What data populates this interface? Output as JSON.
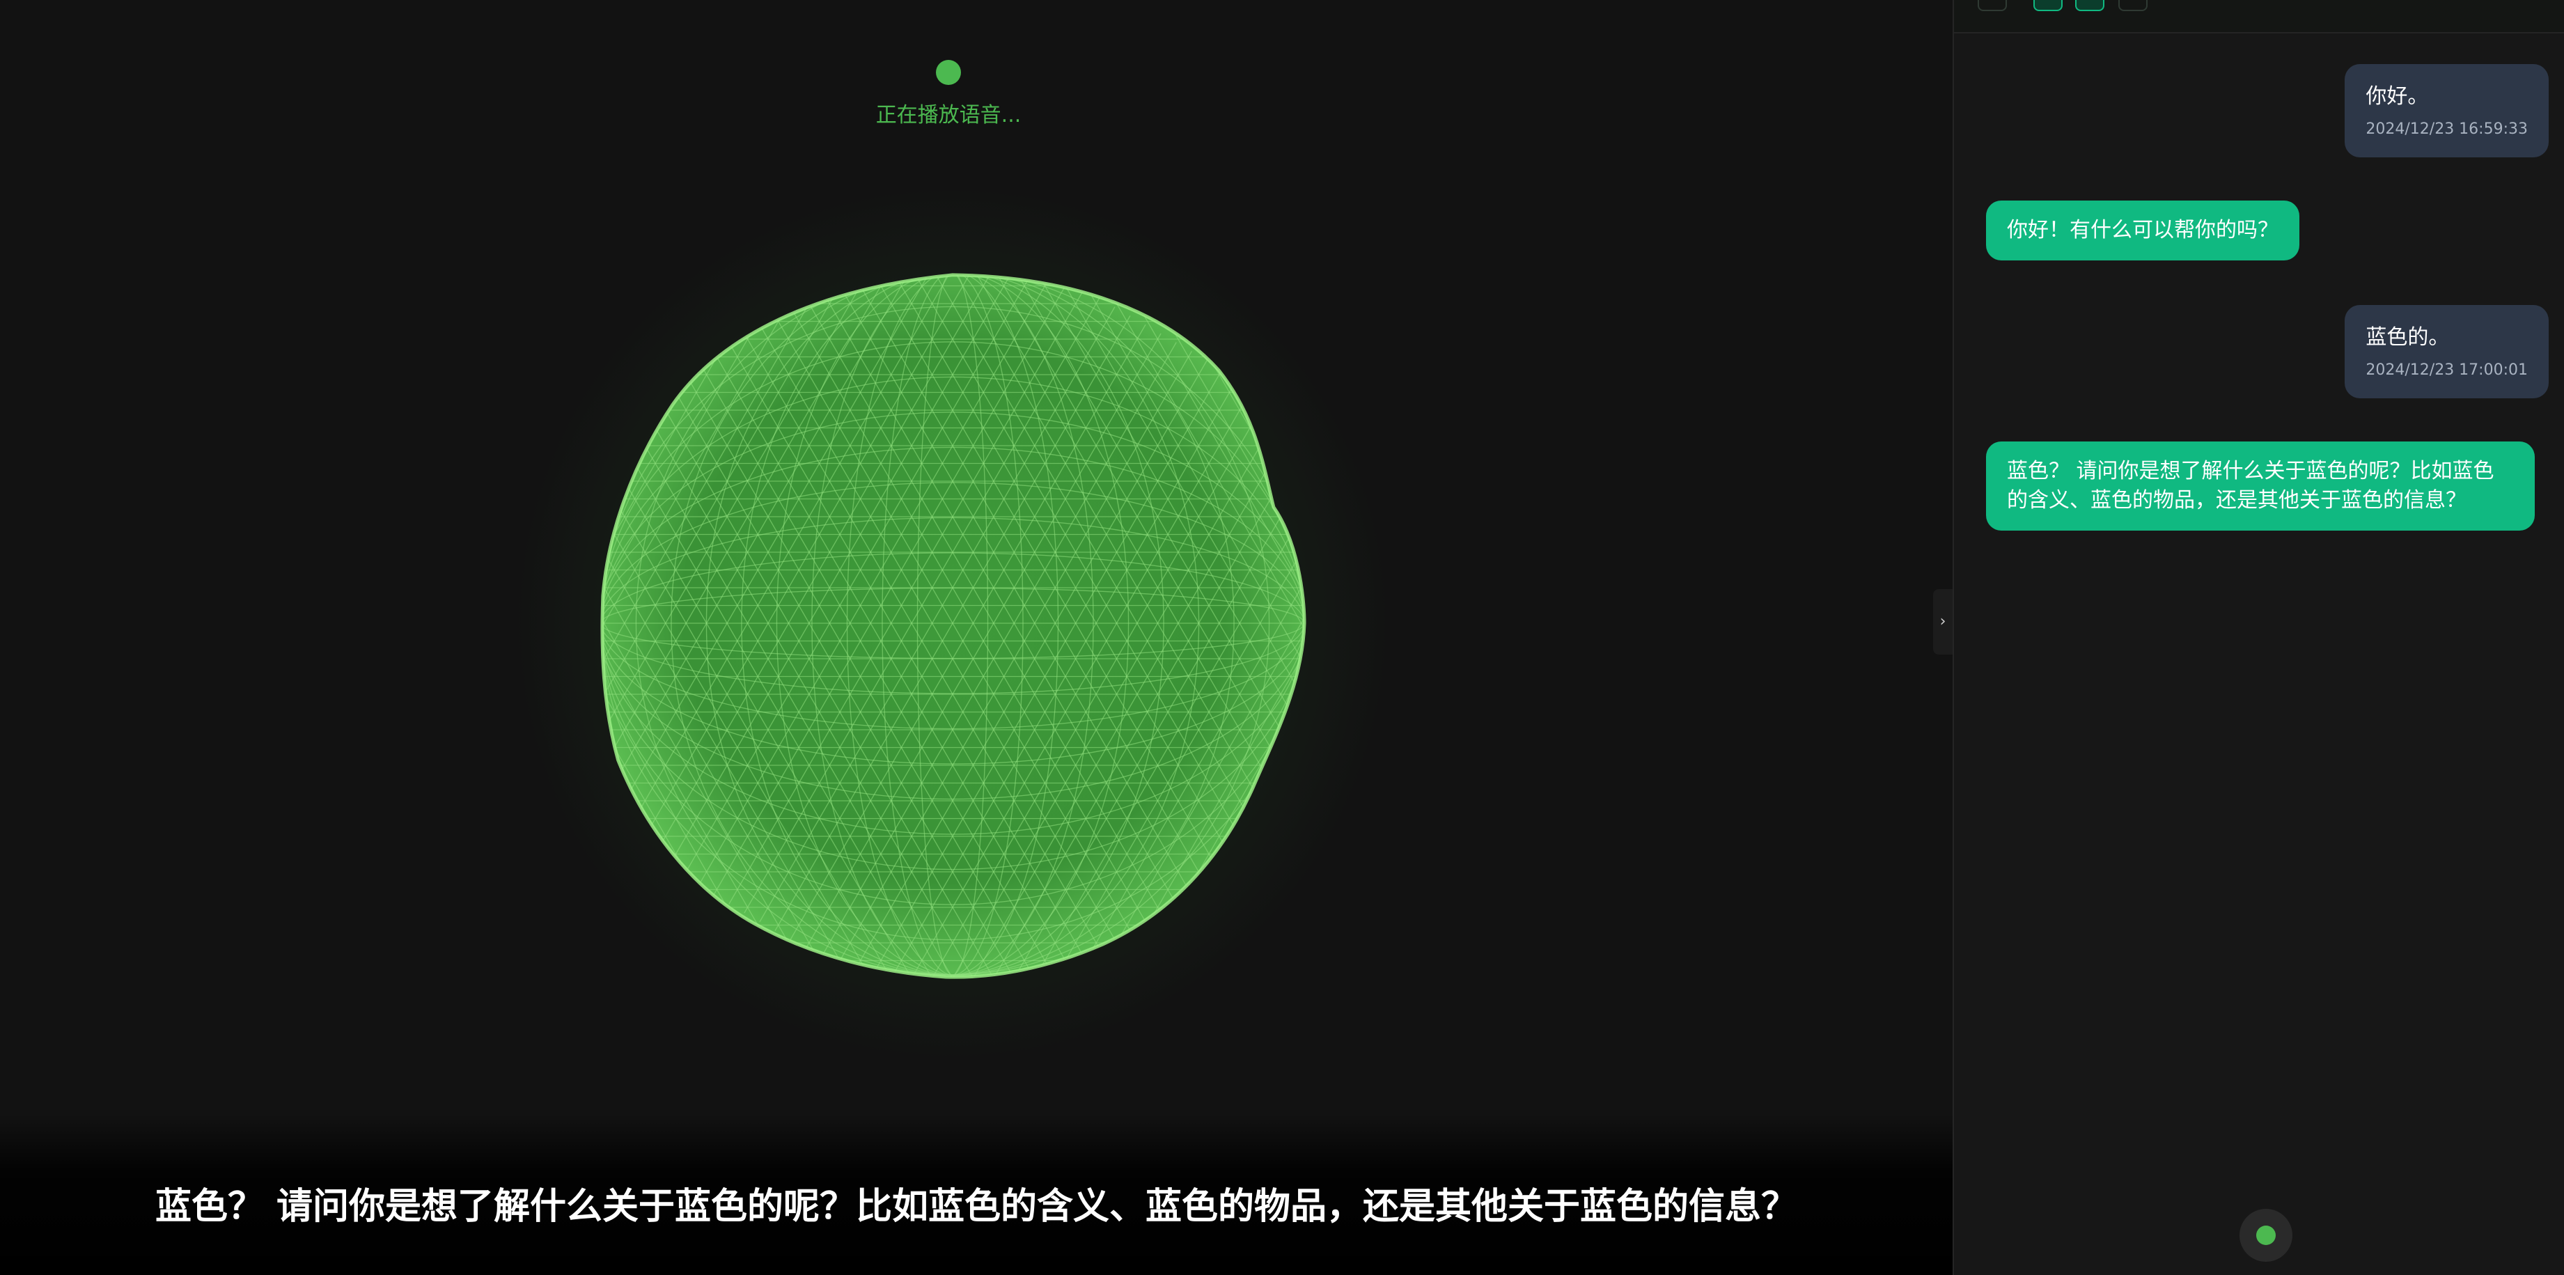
{
  "status": {
    "text": "正在播放语音..."
  },
  "subtitle": {
    "text": "蓝色？ 请问你是想了解什么关于蓝色的呢？比如蓝色的含义、蓝色的物品，还是其他关于蓝色的信息？"
  },
  "chat": {
    "messages": [
      {
        "role": "user",
        "text": "你好。",
        "time": "2024/12/23 16:59:33"
      },
      {
        "role": "assistant",
        "text": "你好！有什么可以帮你的吗？"
      },
      {
        "role": "user",
        "text": "蓝色的。",
        "time": "2024/12/23 17:00:01"
      },
      {
        "role": "assistant",
        "text": "蓝色？ 请问你是想了解什么关于蓝色的呢？比如蓝色的含义、蓝色的物品，还是其他关于蓝色的信息？"
      }
    ]
  },
  "collapse_toggle": {
    "glyph": "›"
  },
  "colors": {
    "background": "#121212",
    "accent_green": "#4cb950",
    "bot_bubble": "#10b981",
    "user_bubble": "#2d3748"
  },
  "icons": [
    "shield-icon",
    "upload-icon",
    "keyboard-icon",
    "settings-icon",
    "record-icon",
    "collapse-icon"
  ]
}
